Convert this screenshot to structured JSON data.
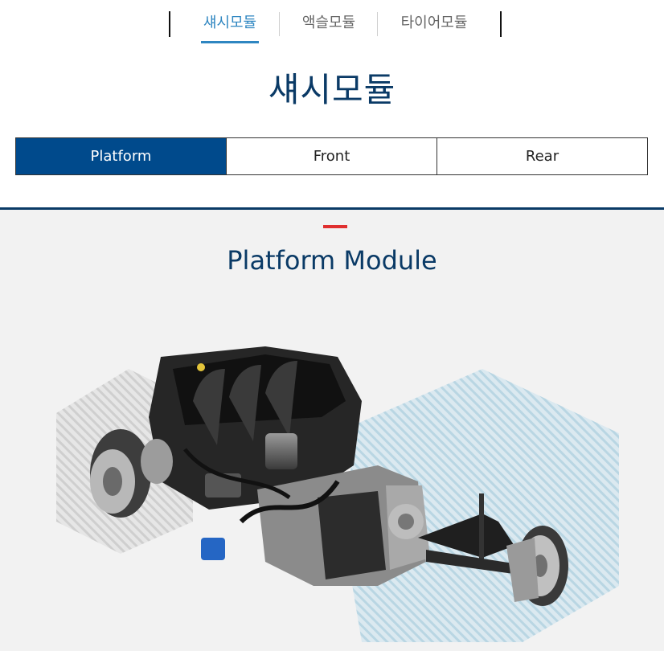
{
  "top_tabs": [
    {
      "label": "섀시모듈",
      "active": true
    },
    {
      "label": "액슬모듈",
      "active": false
    },
    {
      "label": "타이어모듈",
      "active": false
    }
  ],
  "page_title": "섀시모듈",
  "segments": [
    {
      "label": "Platform",
      "active": true
    },
    {
      "label": "Front",
      "active": false
    },
    {
      "label": "Rear",
      "active": false
    }
  ],
  "section": {
    "title": "Platform Module",
    "image": "engine-transmission-suspension-illustration"
  },
  "colors": {
    "accent": "#2e86c1",
    "navy": "#0a3a66",
    "active_segment": "#004a8c",
    "red_mark": "#e03030",
    "background_panel": "#f2f2f2"
  }
}
